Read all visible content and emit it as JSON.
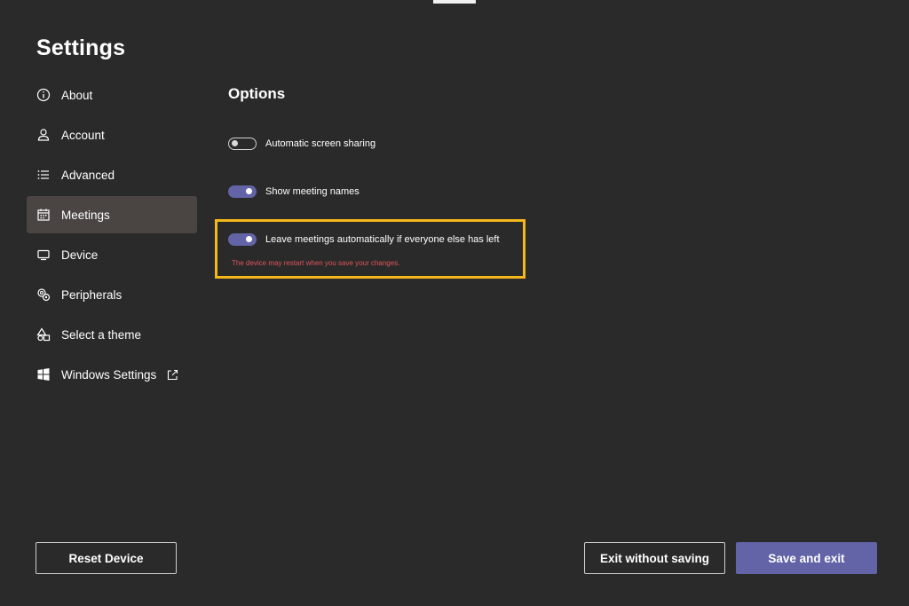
{
  "page": {
    "title": "Settings"
  },
  "sidebar": {
    "items": [
      {
        "label": "About",
        "icon": "info-icon",
        "active": false
      },
      {
        "label": "Account",
        "icon": "person-icon",
        "active": false
      },
      {
        "label": "Advanced",
        "icon": "list-icon",
        "active": false
      },
      {
        "label": "Meetings",
        "icon": "calendar-icon",
        "active": true
      },
      {
        "label": "Device",
        "icon": "monitor-icon",
        "active": false
      },
      {
        "label": "Peripherals",
        "icon": "peripherals-icon",
        "active": false
      },
      {
        "label": "Select a theme",
        "icon": "shapes-icon",
        "active": false
      },
      {
        "label": "Windows Settings",
        "icon": "windows-icon",
        "active": false,
        "external_icon": "external-link-icon"
      }
    ]
  },
  "options": {
    "title": "Options",
    "items": [
      {
        "label": "Automatic screen sharing",
        "state": "off"
      },
      {
        "label": "Show meeting names",
        "state": "on"
      },
      {
        "label": "Leave meetings automatically if everyone else has left",
        "state": "on",
        "highlighted": true
      }
    ],
    "warning": "The device may restart when you save your changes."
  },
  "footer": {
    "reset_label": "Reset Device",
    "exit_label": "Exit without saving",
    "save_label": "Save and exit"
  },
  "colors": {
    "background": "#2a2a2a",
    "accent": "#6264a7",
    "highlight": "#f4b81d",
    "warning": "#e0545c",
    "active_nav": "#4a4443"
  }
}
